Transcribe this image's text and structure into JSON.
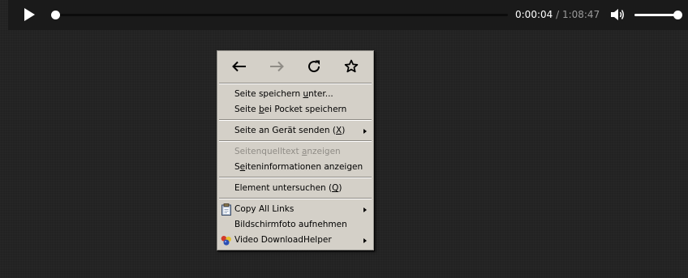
{
  "player": {
    "current_time": "0:00:04",
    "separator": " / ",
    "duration": "1:08:47",
    "progress_fraction": 0.001,
    "volume_fraction": 0.95,
    "icons": {
      "play": "play-icon",
      "volume": "volume-icon"
    }
  },
  "context_menu": {
    "nav_icons": [
      "back-arrow-icon",
      "forward-arrow-icon",
      "reload-icon",
      "bookmark-star-icon"
    ],
    "items": {
      "save_page": {
        "before": "Seite speichern ",
        "accel": "u",
        "after": "nter..."
      },
      "save_pocket": {
        "before": "Seite ",
        "accel": "b",
        "after": "ei Pocket speichern"
      },
      "send_to_device": {
        "before": "Seite an Gerät senden (",
        "accel": "X",
        "after": ")"
      },
      "view_source": {
        "before": "Seitenquelltext ",
        "accel": "a",
        "after": "nzeigen"
      },
      "page_info": {
        "before": "S",
        "accel": "e",
        "after": "iteninformationen anzeigen"
      },
      "inspect": {
        "before": "Element untersuchen (",
        "accel": "Q",
        "after": ")"
      },
      "copy_links": {
        "label": "Copy All Links"
      },
      "screenshot": {
        "label": "Bildschirmfoto aufnehmen"
      },
      "video_helper": {
        "label": "Video DownloadHelper"
      }
    }
  },
  "colors": {
    "background": "#222222",
    "player_bar": "#1a1a1a",
    "menu_face": "#d4d0c8",
    "disabled_text": "#8f8c86"
  }
}
